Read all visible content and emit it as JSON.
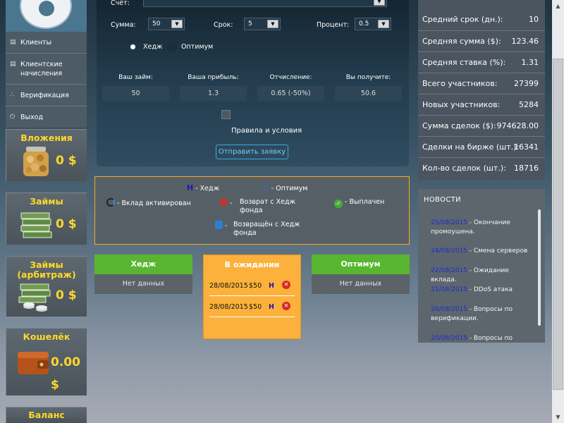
{
  "menu": [
    {
      "label": "Клиенты",
      "icon": "chart-icon"
    },
    {
      "label": "Клиентские начисления",
      "icon": "chart-icon"
    },
    {
      "label": "Верификация",
      "icon": "share-icon"
    },
    {
      "label": "Выход",
      "icon": "power-icon"
    }
  ],
  "tiles": {
    "deposits": {
      "title": "Вложения",
      "amount": "0 $"
    },
    "loans": {
      "title": "Займы",
      "amount": "0 $"
    },
    "arbitrage": {
      "title": "Займы (арбитраж)",
      "amount": "0 $"
    },
    "wallet": {
      "title": "Кошелёк",
      "amount": "0.00 $"
    },
    "balance": {
      "title": "Баланс"
    }
  },
  "form": {
    "account_label": "Счёт:",
    "sum_label": "Сумма:",
    "sum_value": "50",
    "term_label": "Срок:",
    "term_value": "5",
    "percent_label": "Процент:",
    "percent_value": "0.5",
    "radio_hedge": "Хедж",
    "radio_optimum": "Оптимум",
    "col_loan": "Ваш займ:",
    "col_profit": "Ваша прибыль:",
    "col_fee": "Отчисление:",
    "col_receive": "Вы получите:",
    "val_loan": "50",
    "val_profit": "1.3",
    "val_fee": "0.65 (-50%)",
    "val_receive": "50.6",
    "rules": "Правила и условия",
    "submit": "Отправить заявку"
  },
  "legend": {
    "h_glyph": "H",
    "hedge": "Хедж",
    "o_glyph": "O",
    "optimum": "Оптимум",
    "activated": "Вклад активирован",
    "returned_fund": "Возврат с Хедж фонда",
    "paid": "Выплачен",
    "returned_from": "Возвращён с Хедж фонда"
  },
  "columns": {
    "hedge": {
      "title": "Хедж",
      "body": "Нет данных"
    },
    "pending": {
      "title": "В ожидании",
      "rows": [
        {
          "date": "28/08/2015",
          "amount": "$50",
          "type": "H"
        },
        {
          "date": "28/08/2015",
          "amount": "$50",
          "type": "H"
        }
      ]
    },
    "optimum": {
      "title": "Оптимум",
      "body": "Нет данных"
    }
  },
  "stats": [
    {
      "label": "Средний срок (дн.):",
      "value": "10"
    },
    {
      "label": "Средняя сумма ($):",
      "value": "123.46"
    },
    {
      "label": "Средняя ставка (%):",
      "value": "1.31"
    },
    {
      "label": "Всего участников:",
      "value": "27399"
    },
    {
      "label": "Новых участников:",
      "value": "5284"
    },
    {
      "label": "Сумма сделок ($):",
      "value": "974628.00"
    },
    {
      "label": "Сделки на бирже (шт.):",
      "value": "16341"
    },
    {
      "label": "Кол-во сделок (шт.):",
      "value": "18716"
    }
  ],
  "news": {
    "title": "НОВОСТИ",
    "items": [
      {
        "date": "25/08/2015",
        "text": "- Окончание промоушена."
      },
      {
        "date": "24/08/2015",
        "text": "- Смена серверов"
      },
      {
        "date": "22/08/2015",
        "text": "- Ожидание вклада."
      },
      {
        "date": "21/08/2015",
        "text": "- DDoS атака"
      },
      {
        "date": "20/08/2015",
        "text": "- Вопросы по верификации."
      },
      {
        "date": "20/08/2015",
        "text": "- Вопросы по"
      }
    ]
  },
  "colors": {
    "accent": "#ffd82a",
    "hedge_green": "#58b630",
    "pending_orange": "#fbb13b",
    "legend_border": "#f6a91f"
  }
}
